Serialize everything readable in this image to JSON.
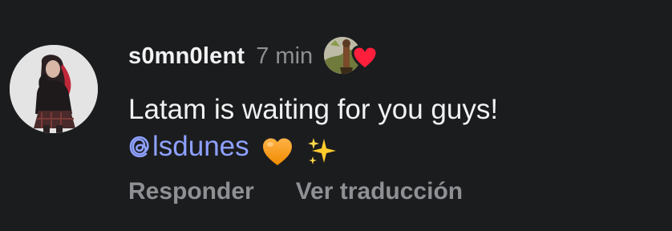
{
  "comment": {
    "username": "s0mn0lent",
    "time": "7 min",
    "text_line1": "Latam is waiting for you guys!",
    "mention": "lsdunes",
    "emojis": [
      "orange-heart",
      "sparkles"
    ],
    "liked_by_author": true,
    "colors": {
      "background": "#1b1c1e",
      "text": "#f2f2f2",
      "muted": "#8f9094",
      "mention": "#8ea1ff",
      "heart": "#ff1f3d"
    }
  },
  "actions": {
    "reply_label": "Responder",
    "translate_label": "Ver traducción"
  }
}
